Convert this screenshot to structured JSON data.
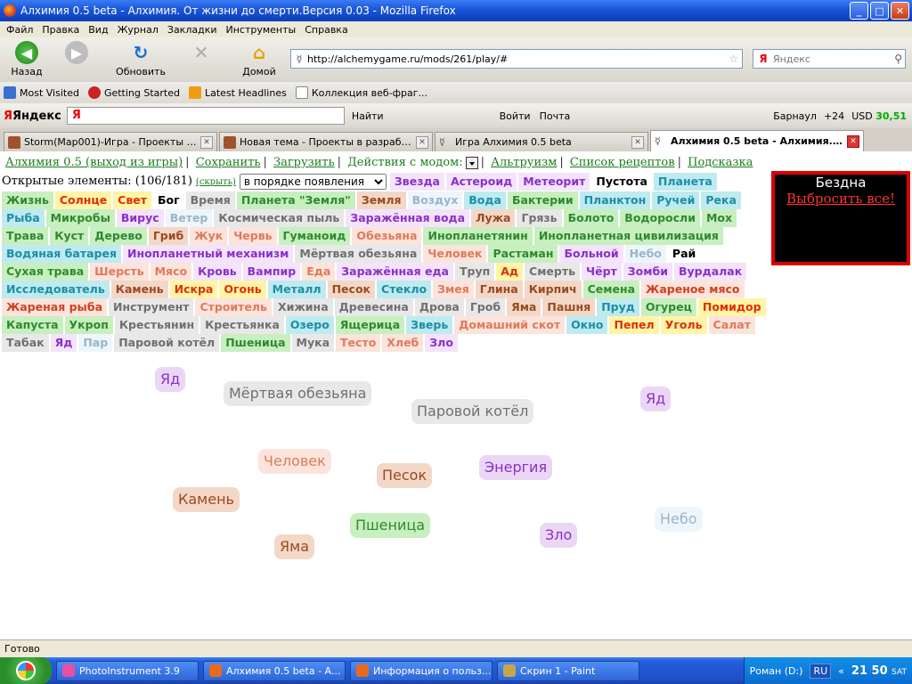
{
  "window": {
    "title": "Алхимия 0.5 beta - Алхимия. От жизни до смерти.Версия 0.03 - Mozilla Firefox"
  },
  "menu": [
    "Файл",
    "Правка",
    "Вид",
    "Журнал",
    "Закладки",
    "Инструменты",
    "Справка"
  ],
  "nav": {
    "back": "Назад",
    "reload": "Обновить",
    "home": "Домой",
    "url": "http://alchemygame.ru/mods/261/play/#",
    "search_placeholder": "Яндекс"
  },
  "bookmarks": [
    "Most Visited",
    "Getting Started",
    "Latest Headlines",
    "Коллекция веб-фраг..."
  ],
  "yandex_bar": {
    "logo": "Яндекс",
    "find": "Найти",
    "login": "Войти",
    "mail": "Почта",
    "city": "Барнаул",
    "temp": "+24",
    "usd_label": "USD",
    "usd_value": "30,51"
  },
  "tabs": [
    {
      "label": "Storm(Map001)-Игра - Проекты в ра...",
      "color": "#a0522d"
    },
    {
      "label": "Новая тема - Проекты в разработк...",
      "color": "#a0522d"
    },
    {
      "label": "Игра Алхимия 0.5 beta",
      "color": "#888888"
    },
    {
      "label": "Алхимия 0.5 beta - Алхимия. От...",
      "color": "#888888"
    }
  ],
  "game_nav": {
    "exit": "Алхимия 0.5 (выход из игры)",
    "save": "Сохранить",
    "load": "Загрузить",
    "mod_actions": "Действия с модом:",
    "altruism": "Альтруизм",
    "recipes": "Список рецептов",
    "hint": "Подсказка"
  },
  "elements_header": {
    "label": "Открытые элементы: (106/181)",
    "hide": "(скрыть)",
    "sort": "в порядке появления"
  },
  "elements": [
    {
      "name": "Звезда",
      "bg": "#f3e4fb",
      "fg": "#8b2fc9"
    },
    {
      "name": "Астероид",
      "bg": "#f3e4fb",
      "fg": "#8b2fc9"
    },
    {
      "name": "Метеорит",
      "bg": "#f3e4fb",
      "fg": "#8b2fc9"
    },
    {
      "name": "Пустота",
      "bg": "#ffffff",
      "fg": "#000000"
    },
    {
      "name": "Планета",
      "bg": "#bfeaf0",
      "fg": "#1b8fa5"
    },
    {
      "name": "Жизнь",
      "bg": "#c8efc0",
      "fg": "#2f8a2f"
    },
    {
      "name": "Солнце",
      "bg": "#fff4a8",
      "fg": "#e03000"
    },
    {
      "name": "Свет",
      "bg": "#fff4a8",
      "fg": "#e03000"
    },
    {
      "name": "Бог",
      "bg": "#ffffff",
      "fg": "#000000"
    },
    {
      "name": "Время",
      "bg": "#e8e8e8",
      "fg": "#707070"
    },
    {
      "name": "Планета \"Земля\"",
      "bg": "#c8efc0",
      "fg": "#2f8a2f"
    },
    {
      "name": "Земля",
      "bg": "#f3d8c8",
      "fg": "#9a4a20"
    },
    {
      "name": "Воздух",
      "bg": "#eef6fb",
      "fg": "#9ab5c8"
    },
    {
      "name": "Вода",
      "bg": "#bfeaf0",
      "fg": "#1b8fa5"
    },
    {
      "name": "Бактерии",
      "bg": "#c8efc0",
      "fg": "#2f8a2f"
    },
    {
      "name": "Планктон",
      "bg": "#bfeaf0",
      "fg": "#1b8fa5"
    },
    {
      "name": "Ручей",
      "bg": "#bfeaf0",
      "fg": "#1b8fa5"
    },
    {
      "name": "Река",
      "bg": "#bfeaf0",
      "fg": "#1b8fa5"
    },
    {
      "name": "Рыба",
      "bg": "#bfeaf0",
      "fg": "#1b8fa5"
    },
    {
      "name": "Микробы",
      "bg": "#c8efc0",
      "fg": "#2f8a2f"
    },
    {
      "name": "Вирус",
      "bg": "#f3e4fb",
      "fg": "#8b2fc9"
    },
    {
      "name": "Ветер",
      "bg": "#eef6fb",
      "fg": "#9ab5c8"
    },
    {
      "name": "Космическая пыль",
      "bg": "#e8e8e8",
      "fg": "#707070"
    },
    {
      "name": "Заражённая вода",
      "bg": "#f3e4fb",
      "fg": "#8b2fc9"
    },
    {
      "name": "Лужа",
      "bg": "#f3d8c8",
      "fg": "#9a4a20"
    },
    {
      "name": "Грязь",
      "bg": "#e8e8e8",
      "fg": "#707070"
    },
    {
      "name": "Болото",
      "bg": "#c8efc0",
      "fg": "#2f8a2f"
    },
    {
      "name": "Водоросли",
      "bg": "#c8efc0",
      "fg": "#2f8a2f"
    },
    {
      "name": "Мох",
      "bg": "#c8efc0",
      "fg": "#2f8a2f"
    },
    {
      "name": "Трава",
      "bg": "#c8efc0",
      "fg": "#2f8a2f"
    },
    {
      "name": "Куст",
      "bg": "#c8efc0",
      "fg": "#2f8a2f"
    },
    {
      "name": "Дерево",
      "bg": "#c8efc0",
      "fg": "#2f8a2f"
    },
    {
      "name": "Гриб",
      "bg": "#f3d8c8",
      "fg": "#9a4a20"
    },
    {
      "name": "Жук",
      "bg": "#fbe4dc",
      "fg": "#e07a5a"
    },
    {
      "name": "Червь",
      "bg": "#fbe4dc",
      "fg": "#e07a5a"
    },
    {
      "name": "Гуманоид",
      "bg": "#c8efc0",
      "fg": "#2f8a2f"
    },
    {
      "name": "Обезьяна",
      "bg": "#fbe4dc",
      "fg": "#e07a5a"
    },
    {
      "name": "Инопланетянин",
      "bg": "#c8efc0",
      "fg": "#2f8a2f"
    },
    {
      "name": "Инопланетная цивилизация",
      "bg": "#c8efc0",
      "fg": "#2f8a2f"
    },
    {
      "name": "Водяная батарея",
      "bg": "#bfeaf0",
      "fg": "#1b8fa5"
    },
    {
      "name": "Инопланетный механизм",
      "bg": "#f3e4fb",
      "fg": "#8b2fc9"
    },
    {
      "name": "Мёртвая обезьяна",
      "bg": "#e8e8e8",
      "fg": "#707070"
    },
    {
      "name": "Человек",
      "bg": "#fbe4dc",
      "fg": "#e07a5a"
    },
    {
      "name": "Растаман",
      "bg": "#c8efc0",
      "fg": "#2f8a2f"
    },
    {
      "name": "Больной",
      "bg": "#f3e4fb",
      "fg": "#8b2fc9"
    },
    {
      "name": "Небо",
      "bg": "#eef6fb",
      "fg": "#9ab5c8"
    },
    {
      "name": "Рай",
      "bg": "#ffffff",
      "fg": "#000000"
    },
    {
      "name": "Сухая трава",
      "bg": "#c8efc0",
      "fg": "#2f8a2f"
    },
    {
      "name": "Шерсть",
      "bg": "#fbe4dc",
      "fg": "#e07a5a"
    },
    {
      "name": "Мясо",
      "bg": "#fbe4dc",
      "fg": "#e07a5a"
    },
    {
      "name": "Кровь",
      "bg": "#f3e4fb",
      "fg": "#8b2fc9"
    },
    {
      "name": "Вампир",
      "bg": "#f3e4fb",
      "fg": "#8b2fc9"
    },
    {
      "name": "Еда",
      "bg": "#fbe4dc",
      "fg": "#e07a5a"
    },
    {
      "name": "Заражённая еда",
      "bg": "#f3e4fb",
      "fg": "#8b2fc9"
    },
    {
      "name": "Труп",
      "bg": "#e8e8e8",
      "fg": "#707070"
    },
    {
      "name": "Ад",
      "bg": "#fff4a8",
      "fg": "#e03000"
    },
    {
      "name": "Смерть",
      "bg": "#e8e8e8",
      "fg": "#707070"
    },
    {
      "name": "Чёрт",
      "bg": "#f3e4fb",
      "fg": "#8b2fc9"
    },
    {
      "name": "Зомби",
      "bg": "#f3e4fb",
      "fg": "#8b2fc9"
    },
    {
      "name": "Вурдалак",
      "bg": "#f3e4fb",
      "fg": "#8b2fc9"
    },
    {
      "name": "Исследователь",
      "bg": "#bfeaf0",
      "fg": "#1b8fa5"
    },
    {
      "name": "Камень",
      "bg": "#f3d8c8",
      "fg": "#9a4a20"
    },
    {
      "name": "Искра",
      "bg": "#fff4a8",
      "fg": "#e03000"
    },
    {
      "name": "Огонь",
      "bg": "#fff4a8",
      "fg": "#e03000"
    },
    {
      "name": "Металл",
      "bg": "#bfeaf0",
      "fg": "#1b8fa5"
    },
    {
      "name": "Песок",
      "bg": "#f3d8c8",
      "fg": "#9a4a20"
    },
    {
      "name": "Стекло",
      "bg": "#bfeaf0",
      "fg": "#1b8fa5"
    },
    {
      "name": "Змея",
      "bg": "#fbe4dc",
      "fg": "#e07a5a"
    },
    {
      "name": "Глина",
      "bg": "#f3d8c8",
      "fg": "#9a4a20"
    },
    {
      "name": "Кирпич",
      "bg": "#f3d8c8",
      "fg": "#9a4a20"
    },
    {
      "name": "Семена",
      "bg": "#c8efc0",
      "fg": "#2f8a2f"
    },
    {
      "name": "Жареное мясо",
      "bg": "#fbe4dc",
      "fg": "#d04020"
    },
    {
      "name": "Жареная рыба",
      "bg": "#fbe4dc",
      "fg": "#d04020"
    },
    {
      "name": "Инструмент",
      "bg": "#e8e8e8",
      "fg": "#707070"
    },
    {
      "name": "Строитель",
      "bg": "#fbe4dc",
      "fg": "#e07a5a"
    },
    {
      "name": "Хижина",
      "bg": "#e8e8e8",
      "fg": "#707070"
    },
    {
      "name": "Древесина",
      "bg": "#e8e8e8",
      "fg": "#707070"
    },
    {
      "name": "Дрова",
      "bg": "#e8e8e8",
      "fg": "#707070"
    },
    {
      "name": "Гроб",
      "bg": "#e8e8e8",
      "fg": "#707070"
    },
    {
      "name": "Яма",
      "bg": "#f3d8c8",
      "fg": "#9a4a20"
    },
    {
      "name": "Пашня",
      "bg": "#f3d8c8",
      "fg": "#9a4a20"
    },
    {
      "name": "Пруд",
      "bg": "#bfeaf0",
      "fg": "#1b8fa5"
    },
    {
      "name": "Огурец",
      "bg": "#c8efc0",
      "fg": "#2f8a2f"
    },
    {
      "name": "Помидор",
      "bg": "#fff4a8",
      "fg": "#e03000"
    },
    {
      "name": "Капуста",
      "bg": "#c8efc0",
      "fg": "#2f8a2f"
    },
    {
      "name": "Укроп",
      "bg": "#c8efc0",
      "fg": "#2f8a2f"
    },
    {
      "name": "Крестьянин",
      "bg": "#e8e8e8",
      "fg": "#707070"
    },
    {
      "name": "Крестьянка",
      "bg": "#e8e8e8",
      "fg": "#707070"
    },
    {
      "name": "Озеро",
      "bg": "#bfeaf0",
      "fg": "#1b8fa5"
    },
    {
      "name": "Ящерица",
      "bg": "#c8efc0",
      "fg": "#2f8a2f"
    },
    {
      "name": "Зверь",
      "bg": "#bfeaf0",
      "fg": "#1b8fa5"
    },
    {
      "name": "Домашний скот",
      "bg": "#fbe4dc",
      "fg": "#e07a5a"
    },
    {
      "name": "Окно",
      "bg": "#bfeaf0",
      "fg": "#1b8fa5"
    },
    {
      "name": "Пепел",
      "bg": "#fff4a8",
      "fg": "#e03000"
    },
    {
      "name": "Уголь",
      "bg": "#fff4a8",
      "fg": "#e03000"
    },
    {
      "name": "Салат",
      "bg": "#fbe4dc",
      "fg": "#e07a5a"
    },
    {
      "name": "Табак",
      "bg": "#e8e8e8",
      "fg": "#707070"
    },
    {
      "name": "Яд",
      "bg": "#f3e4fb",
      "fg": "#8b2fc9"
    },
    {
      "name": "Пар",
      "bg": "#eef6fb",
      "fg": "#9ab5c8"
    },
    {
      "name": "Паровой котёл",
      "bg": "#e8e8e8",
      "fg": "#707070"
    },
    {
      "name": "Пшеница",
      "bg": "#c8efc0",
      "fg": "#2f8a2f"
    },
    {
      "name": "Мука",
      "bg": "#e8e8e8",
      "fg": "#707070"
    },
    {
      "name": "Тесто",
      "bg": "#fbe4dc",
      "fg": "#e07a5a"
    },
    {
      "name": "Хлеб",
      "bg": "#fbe4dc",
      "fg": "#e07a5a"
    },
    {
      "name": "Зло",
      "bg": "#f3e4fb",
      "fg": "#8b2fc9"
    }
  ],
  "abyss": {
    "title": "Бездна",
    "throw_all": "Выбросить все!"
  },
  "field": [
    {
      "name": "Яд",
      "bg": "#ead7f5",
      "fg": "#8b2fc9"
    },
    {
      "name": "Мёртвая обезьяна",
      "bg": "#e8e8e8",
      "fg": "#707070"
    },
    {
      "name": "Паровой котёл",
      "bg": "#e8e8e8",
      "fg": "#707070"
    },
    {
      "name": "Яд",
      "bg": "#ead7f5",
      "fg": "#8b2fc9"
    },
    {
      "name": "Человек",
      "bg": "#fbe4dc",
      "fg": "#e07a5a"
    },
    {
      "name": "Песок",
      "bg": "#f3d8c8",
      "fg": "#9a4a20"
    },
    {
      "name": "Энергия",
      "bg": "#ead7f5",
      "fg": "#8b2fc9"
    },
    {
      "name": "Камень",
      "bg": "#f3d8c8",
      "fg": "#9a4a20"
    },
    {
      "name": "Небо",
      "bg": "#eef6fb",
      "fg": "#9ab5c8"
    },
    {
      "name": "Пшеница",
      "bg": "#c8efc0",
      "fg": "#2f8a2f"
    },
    {
      "name": "Яма",
      "bg": "#f3d8c8",
      "fg": "#9a4a20"
    },
    {
      "name": "Зло",
      "bg": "#ead7f5",
      "fg": "#8b2fc9"
    }
  ],
  "status": "Готово",
  "taskbar": {
    "tasks": [
      {
        "label": "PhotoInstrument 3.9",
        "color": "#e84fa0"
      },
      {
        "label": "Алхимия 0.5 beta - А...",
        "color": "#e86a1a"
      },
      {
        "label": "Информация о польз...",
        "color": "#e86a1a"
      },
      {
        "label": "Скрин 1 - Paint",
        "color": "#c9a54a"
      }
    ],
    "drive": "Роман (D:)",
    "lang": "RU",
    "time": "21 50",
    "day": "SAT"
  }
}
